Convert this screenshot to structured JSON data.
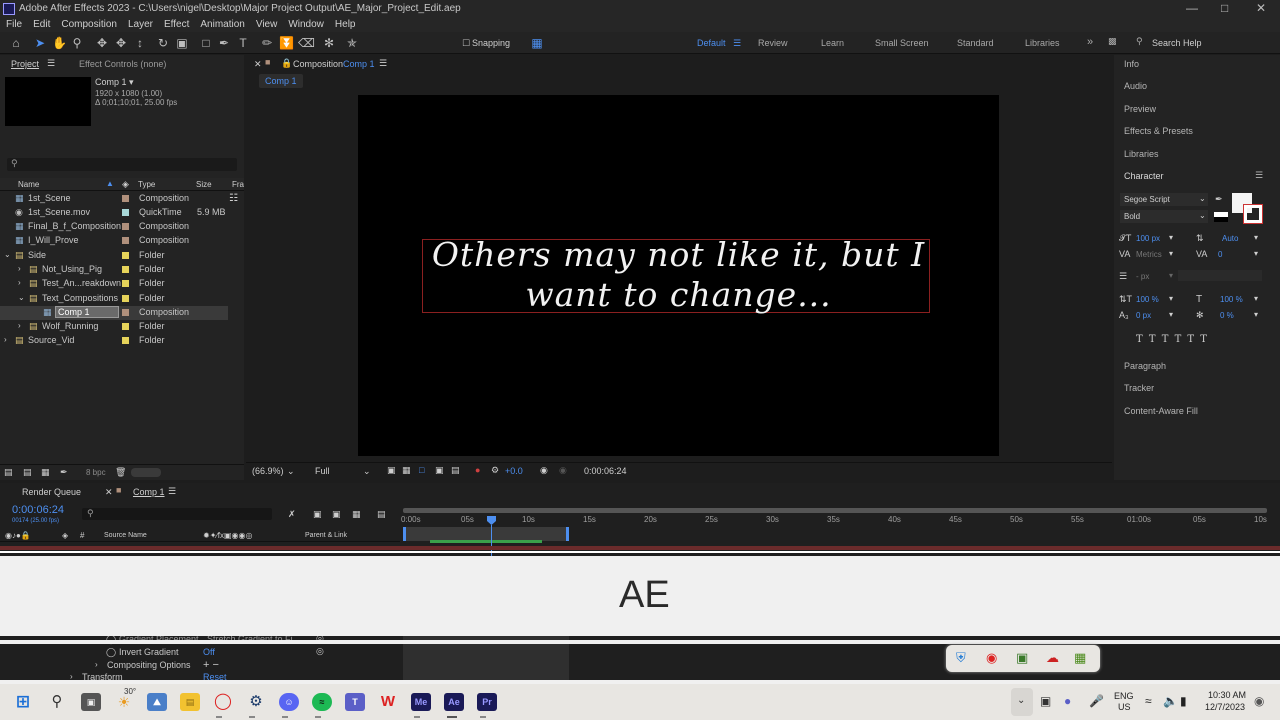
{
  "window": {
    "title": "Adobe After Effects 2023 - C:\\Users\\nigel\\Desktop\\Major Project Output\\AE_Major_Project_Edit.aep"
  },
  "menu": [
    "File",
    "Edit",
    "Composition",
    "Layer",
    "Effect",
    "Animation",
    "View",
    "Window",
    "Help"
  ],
  "toolbar": {
    "snapping": "Snapping"
  },
  "workspaces": [
    "Default",
    "Review",
    "Learn",
    "Small Screen",
    "Standard",
    "Libraries"
  ],
  "search_help": "Search Help",
  "project": {
    "tab": "Project",
    "effect_controls": "Effect Controls (none)",
    "selected_name": "Comp 1 ▾",
    "selected_info1": "1920 x 1080 (1.00)",
    "selected_info2": "Δ 0;01;10;01, 25.00 fps",
    "bpc": "8 bpc",
    "columns": {
      "name": "Name",
      "type": "Type",
      "size": "Size",
      "frame": "Fra"
    },
    "items": [
      {
        "name": "1st_Scene",
        "type": "Composition",
        "size": ""
      },
      {
        "name": "1st_Scene.mov",
        "type": "QuickTime",
        "size": "5.9 MB"
      },
      {
        "name": "Final_B_f_Composition",
        "type": "Composition",
        "size": ""
      },
      {
        "name": "I_Will_Prove",
        "type": "Composition",
        "size": ""
      },
      {
        "name": "Side",
        "type": "Folder",
        "size": ""
      },
      {
        "name": "Not_Using_Pig",
        "type": "Folder",
        "size": ""
      },
      {
        "name": "Test_An...reakdown",
        "type": "Folder",
        "size": ""
      },
      {
        "name": "Text_Compositions",
        "type": "Folder",
        "size": ""
      },
      {
        "name": "Comp 1",
        "type": "Composition",
        "size": ""
      },
      {
        "name": "Wolf_Running",
        "type": "Folder",
        "size": ""
      },
      {
        "name": "Source_Vid",
        "type": "Folder",
        "size": ""
      }
    ]
  },
  "composition": {
    "tab_prefix": "Composition",
    "tab_name": "Comp 1",
    "breadcrumb": "Comp 1",
    "text_line1": "Others may not like it, but I",
    "text_line2": "want to change...",
    "zoom": "(66.9%)",
    "resolution": "Full",
    "exposure": "+0.0",
    "timecode": "0:00:06:24"
  },
  "right_panels": {
    "top": [
      "Info",
      "Audio",
      "Preview",
      "Effects & Presets",
      "Libraries"
    ],
    "character": {
      "title": "Character",
      "font": "Segoe Script",
      "style": "Bold",
      "font_size": "100 px",
      "leading": "Auto",
      "kerning": "Metrics",
      "tracking": "0",
      "stroke": "- px",
      "vscale": "100 %",
      "hscale": "100 %",
      "baseline": "0 px",
      "tsume": "0 %"
    },
    "bottom": [
      "Paragraph",
      "Tracker",
      "Content-Aware Fill"
    ]
  },
  "timeline": {
    "render_queue": "Render Queue",
    "comp_tab": "Comp 1",
    "timecode": "0:00:06:24",
    "frames": "00174 (25.00 fps)",
    "col_source": "Source Name",
    "col_parent": "Parent & Link",
    "ruler": [
      "0:00s",
      "05s",
      "10s",
      "15s",
      "20s",
      "25s",
      "30s",
      "35s",
      "40s",
      "45s",
      "50s",
      "55s",
      "01:00s",
      "05s",
      "10s"
    ],
    "props": [
      {
        "name": "Gradient Placement",
        "value": "Stretch Gradient to Fi"
      },
      {
        "name": "Invert Gradient",
        "value": "Off"
      },
      {
        "name": "Compositing Options",
        "value": "+ −"
      },
      {
        "name": "Transform",
        "value": "Reset"
      }
    ]
  },
  "overlay": {
    "text": "AE"
  },
  "taskbar": {
    "weather": "30°",
    "lang1": "ENG",
    "lang2": "US",
    "time": "10:30 AM",
    "date": "12/7/2023"
  },
  "colors": {
    "accent": "#4d8ff0",
    "composition_swatch": "#b0907c",
    "folder_swatch": "#e6d35a",
    "quicktime_swatch": "#a8d8d8"
  }
}
